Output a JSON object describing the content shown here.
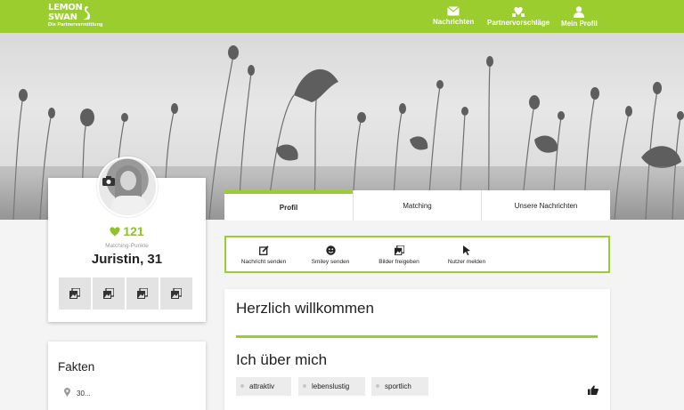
{
  "brand": {
    "line1": "LEMON",
    "line2": "SWAN",
    "tagline": "Die Partnervermittlung"
  },
  "nav": [
    {
      "label": "Nachrichten",
      "icon": "envelope-icon"
    },
    {
      "label": "Partnervorschläge",
      "icon": "heart-hands-icon"
    },
    {
      "label": "Mein Profil",
      "icon": "user-icon"
    }
  ],
  "profile": {
    "score": "121",
    "points_label": "Matching-Punkte",
    "name": "Juristin, 31"
  },
  "facts": {
    "title": "Fakten",
    "location": "30..."
  },
  "tabs": [
    {
      "label": "Profil",
      "active": true
    },
    {
      "label": "Matching",
      "active": false
    },
    {
      "label": "Unsere Nachrichten",
      "active": false
    }
  ],
  "actions": [
    {
      "label": "Nachricht senden",
      "icon": "compose-icon"
    },
    {
      "label": "Smiley senden",
      "icon": "smiley-icon"
    },
    {
      "label": "Bilder freigeben",
      "icon": "images-icon"
    },
    {
      "label": "Nutzer melden",
      "icon": "flag-cursor-icon"
    }
  ],
  "content": {
    "welcome": "Herzlich willkommen",
    "about": "Ich über mich",
    "tags": [
      "attraktiv",
      "lebenslustig",
      "sportlich"
    ]
  },
  "colors": {
    "brand_green": "#9ccd2f",
    "score_green": "#8fc32b"
  }
}
